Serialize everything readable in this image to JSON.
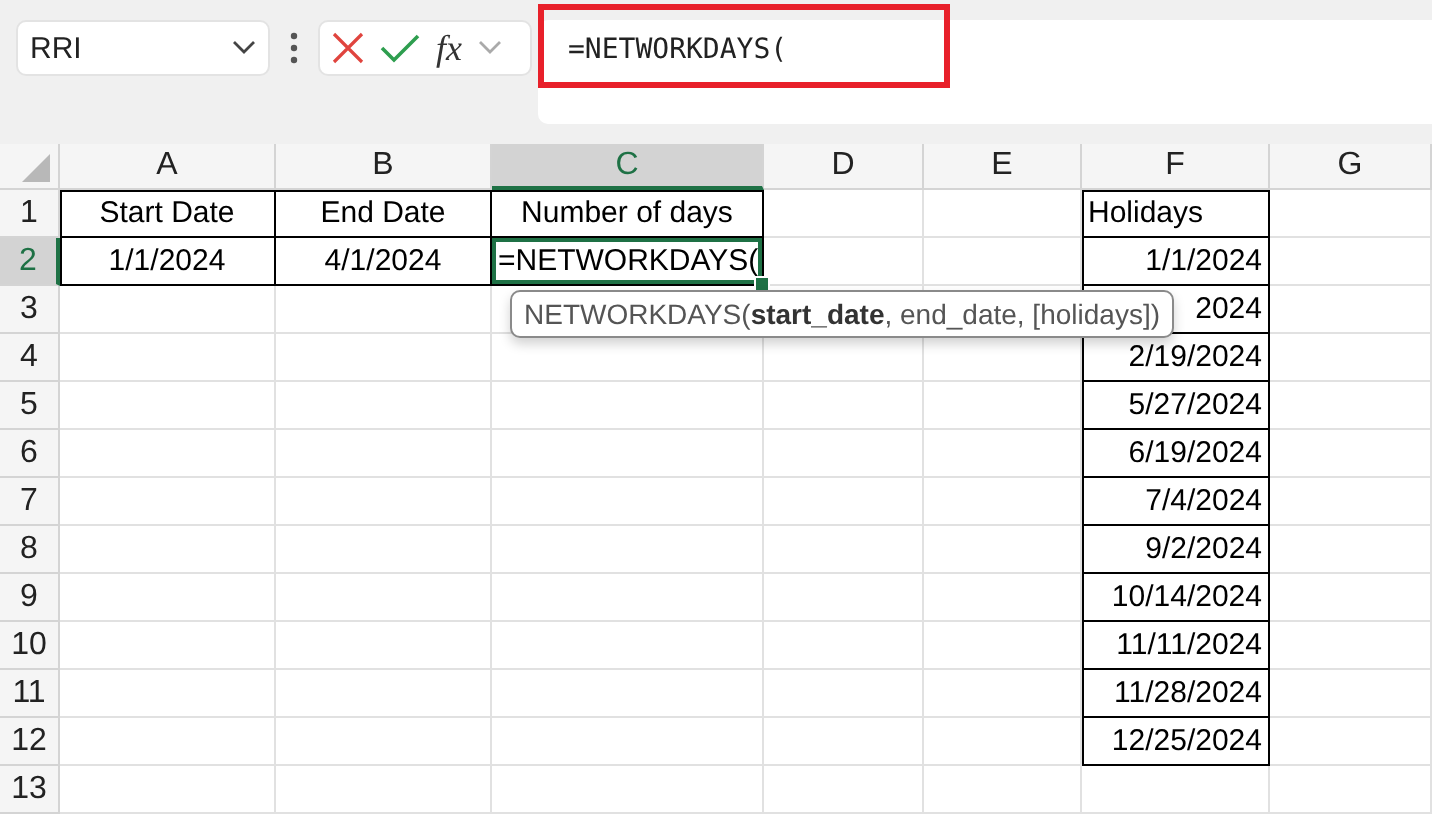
{
  "name_box": {
    "value": "RRI"
  },
  "formula_bar": {
    "function_label": "fx",
    "value": "=NETWORKDAYS(",
    "highlighted": true
  },
  "columns": [
    {
      "label": "A",
      "selected": false
    },
    {
      "label": "B",
      "selected": false
    },
    {
      "label": "C",
      "selected": true
    },
    {
      "label": "D",
      "selected": false
    },
    {
      "label": "E",
      "selected": false
    },
    {
      "label": "F",
      "selected": false
    },
    {
      "label": "G",
      "selected": false
    }
  ],
  "rows": [
    {
      "label": "1",
      "selected": false,
      "cells": [
        {
          "text": "Start Date",
          "kind": "heading"
        },
        {
          "text": "End Date",
          "kind": "heading"
        },
        {
          "text": "Number of days",
          "kind": "heading"
        },
        null,
        null,
        {
          "text": "Holidays",
          "kind": "label"
        },
        null
      ]
    },
    {
      "label": "2",
      "selected": true,
      "cells": [
        {
          "text": "1/1/2024",
          "kind": "heading"
        },
        {
          "text": "4/1/2024",
          "kind": "heading"
        },
        {
          "text": "=NETWORKDAYS(",
          "kind": "input"
        },
        null,
        null,
        {
          "text": "1/1/2024",
          "kind": "date"
        },
        null
      ]
    },
    {
      "label": "3",
      "selected": false,
      "cells": [
        null,
        null,
        null,
        null,
        null,
        {
          "text": "2024",
          "kind": "date"
        },
        null
      ]
    },
    {
      "label": "4",
      "selected": false,
      "cells": [
        null,
        null,
        null,
        null,
        null,
        {
          "text": "2/19/2024",
          "kind": "date"
        },
        null
      ]
    },
    {
      "label": "5",
      "selected": false,
      "cells": [
        null,
        null,
        null,
        null,
        null,
        {
          "text": "5/27/2024",
          "kind": "date"
        },
        null
      ]
    },
    {
      "label": "6",
      "selected": false,
      "cells": [
        null,
        null,
        null,
        null,
        null,
        {
          "text": "6/19/2024",
          "kind": "date"
        },
        null
      ]
    },
    {
      "label": "7",
      "selected": false,
      "cells": [
        null,
        null,
        null,
        null,
        null,
        {
          "text": "7/4/2024",
          "kind": "date"
        },
        null
      ]
    },
    {
      "label": "8",
      "selected": false,
      "cells": [
        null,
        null,
        null,
        null,
        null,
        {
          "text": "9/2/2024",
          "kind": "date"
        },
        null
      ]
    },
    {
      "label": "9",
      "selected": false,
      "cells": [
        null,
        null,
        null,
        null,
        null,
        {
          "text": "10/14/2024",
          "kind": "date"
        },
        null
      ]
    },
    {
      "label": "10",
      "selected": false,
      "cells": [
        null,
        null,
        null,
        null,
        null,
        {
          "text": "11/11/2024",
          "kind": "date"
        },
        null
      ]
    },
    {
      "label": "11",
      "selected": false,
      "cells": [
        null,
        null,
        null,
        null,
        null,
        {
          "text": "11/28/2024",
          "kind": "date"
        },
        null
      ]
    },
    {
      "label": "12",
      "selected": false,
      "cells": [
        null,
        null,
        null,
        null,
        null,
        {
          "text": "12/25/2024",
          "kind": "date"
        },
        null
      ]
    },
    {
      "label": "13",
      "selected": false,
      "cells": [
        null,
        null,
        null,
        null,
        null,
        null,
        null
      ]
    }
  ],
  "tooltip": {
    "text": "NETWORKDAYS(**start_date**, end_date, [holidays])"
  }
}
